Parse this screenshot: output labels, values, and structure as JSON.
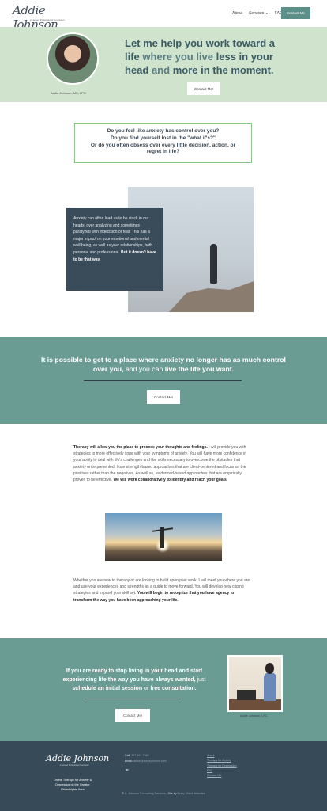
{
  "header": {
    "logo_script": "Addie Johnson",
    "logo_sub": "Licensed Professional Counselor",
    "nav": [
      "About",
      "Services",
      "FAQs"
    ],
    "services_chevron": "⌄",
    "contact_button": "Contact Me"
  },
  "hero": {
    "caption": "Addie Johnson, MS, LPC",
    "line1_a": "Let me help you work toward a",
    "line2_a": "life",
    "line2_b": " where you live ",
    "line2_c": "less in your",
    "line3_a": "head",
    "line3_b": " and ",
    "line3_c": "more in the moment.",
    "button": "Contact Me!"
  },
  "question": {
    "l1": "Do you feel like anxiety has control over you?",
    "l2": "Do you find yourself lost in the \"what if's?\"",
    "l3": "Or do you often obsess over every little decision, action, or",
    "l4": "regret in life?"
  },
  "overlay": {
    "text": "Anxiety can often lead us to be stuck in our heads, over analyzing and sometimes paralyzed with indecision or fear. This has a major impact on your emotional and mental well being, as well as your relationships, both personal and professional. ",
    "bold": "But it doesn't have to be that way."
  },
  "band1": {
    "a": "It is possible to get to a place where anxiety no longer has as much control over you,",
    "b": " and you can ",
    "c": "live the life you want.",
    "button": "Contact Me!"
  },
  "para1": {
    "lead": "Therapy will allow you the place to process your thoughts and feelings.",
    "body": " I will provide you with strategies to more effectively cope with your symptoms of anxiety. You will have more confidence in your ability to deal with life's challenges and the skills necessary to overcome the obstacles that anxiety once presented. I use strength-based approaches that are client-centered and focus on the positives rather than the negatives. As well as, evidenced-based approaches that are empirically proven to be effective. ",
    "end": "We will work collaboratively to identify and reach your goals."
  },
  "para2": {
    "body": "Whether you are new to therapy or are looking to build upon past work, I will meet you where you are and use your experiences and strengths as a guide to move forward. You will develop new coping strategies and expand your skill set. ",
    "end": "You will begin to recognize that you have agency to transform the way you have been approaching your life."
  },
  "band2": {
    "a": "If you are ready to stop living in your head and start experiencing life the way you have always wanted,",
    "b": " just ",
    "c": "schedule an initial session",
    "d": " or ",
    "e": "free consultation.",
    "button": "Contact Me!",
    "photo_caption": "Addie Johnson, LPC"
  },
  "footer": {
    "logo": "Addie Johnson",
    "logo_sub": "Licensed Professional Counselor",
    "tagline": "Online Therapy for Anxiety & Depression in the Greater Philadelphia Area",
    "call_label": "Call:",
    "call_value": "267-461-7360",
    "email_label": "Email:",
    "email_value": "addie@addiejohnson.com",
    "linkedin": "in",
    "links": [
      "About",
      "Therapy for Anxiety",
      "Therapy for Depression",
      "FAQ",
      "Contact Me"
    ],
    "copy_a": "© ",
    "copy_b": "A. Johnson Counseling Services",
    "copy_c": "  |  Site by ",
    "copy_d": "Every Client Websites"
  }
}
